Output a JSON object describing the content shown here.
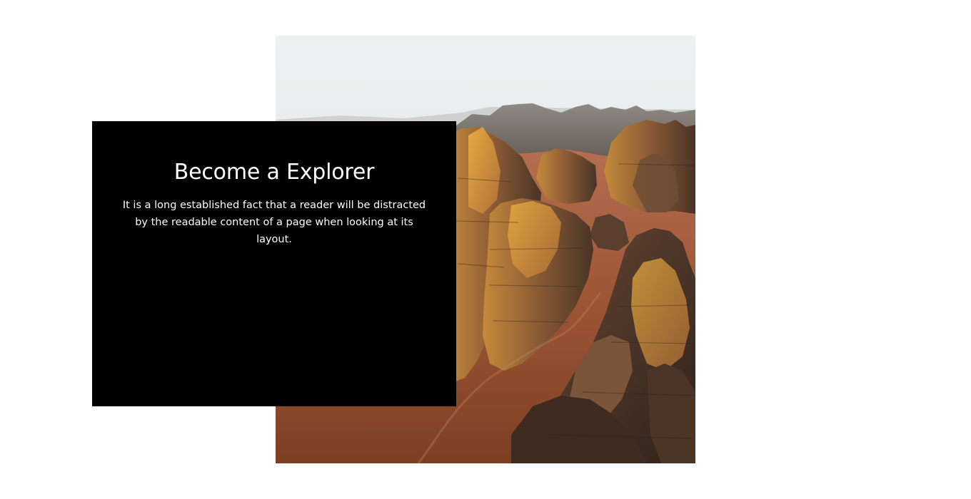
{
  "hero": {
    "title": "Become a Explorer",
    "description": "It is a long established fact that a reader will be distracted by the readable content of a page when looking at its layout."
  },
  "colors": {
    "card_background": "#000000",
    "card_text": "#ffffff",
    "page_background": "#ffffff"
  },
  "image": {
    "subject": "aerial view of desert sandstone rock formations at sunset"
  }
}
